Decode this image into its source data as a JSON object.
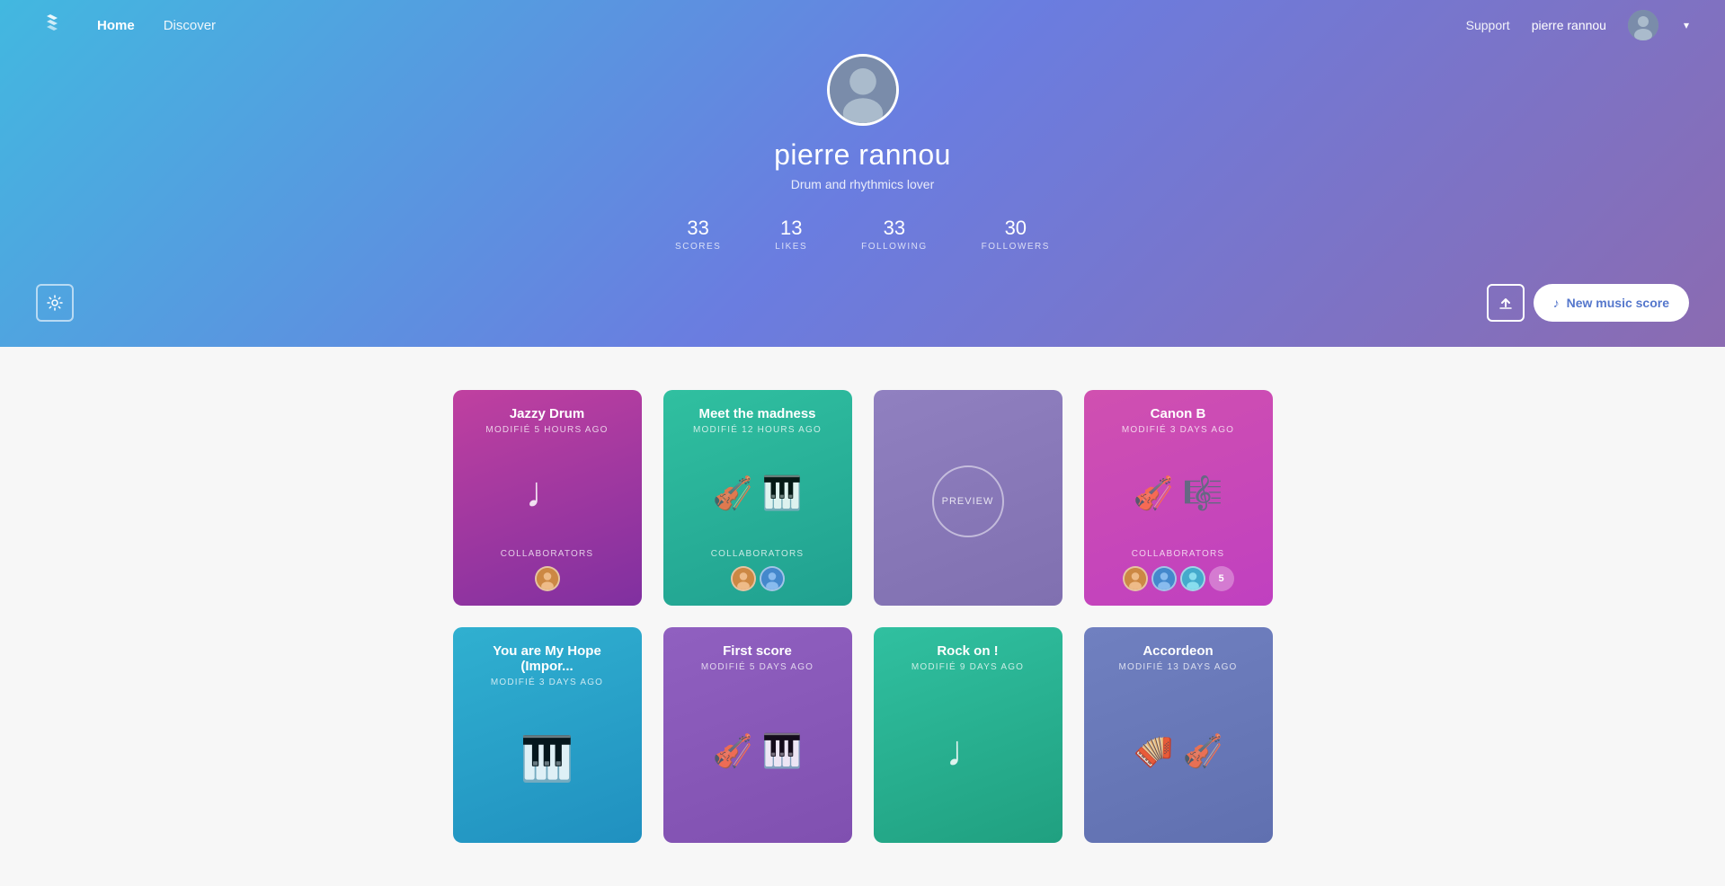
{
  "nav": {
    "links": [
      {
        "label": "Home",
        "active": true
      },
      {
        "label": "Discover",
        "active": false
      }
    ],
    "support_label": "Support",
    "username": "pierre rannou",
    "chevron": "▾"
  },
  "hero": {
    "name": "pierre rannou",
    "bio": "Drum and rhythmics lover",
    "stats": [
      {
        "number": "33",
        "label": "SCORES"
      },
      {
        "number": "13",
        "label": "LIKES"
      },
      {
        "number": "33",
        "label": "FOLLOWING"
      },
      {
        "number": "30",
        "label": "FOLLOWERS"
      }
    ],
    "new_score_label": "New music score"
  },
  "scores": [
    {
      "title": "Jazzy Drum",
      "modified": "MODIFIÉ 5 HOURS AGO",
      "color_class": "card-jazzy",
      "icon": "note",
      "collaborators": 1
    },
    {
      "title": "Meet the madness",
      "modified": "MODIFIÉ 12 HOURS AGO",
      "color_class": "card-madness",
      "icon": "violin-piano",
      "collaborators": 2
    },
    {
      "title": "",
      "modified": "",
      "color_class": "card-preview",
      "icon": "preview",
      "collaborators": 0
    },
    {
      "title": "Canon B",
      "modified": "MODIFIÉ 3 DAYS AGO",
      "color_class": "card-canon",
      "icon": "violin-sheet",
      "collaborators": 5
    },
    {
      "title": "You are My Hope (Impor...",
      "modified": "MODIFIÉ 3 DAYS AGO",
      "color_class": "card-hope",
      "icon": "piano",
      "collaborators": 0
    },
    {
      "title": "First score",
      "modified": "MODIFIÉ 5 DAYS AGO",
      "color_class": "card-first",
      "icon": "violin-piano",
      "collaborators": 0
    },
    {
      "title": "Rock on !",
      "modified": "MODIFIÉ 9 DAYS AGO",
      "color_class": "card-rock",
      "icon": "note",
      "collaborators": 0
    },
    {
      "title": "Accordeon",
      "modified": "MODIFIÉ 13 DAYS AGO",
      "color_class": "card-accord",
      "icon": "accordion-violin",
      "collaborators": 0
    }
  ]
}
